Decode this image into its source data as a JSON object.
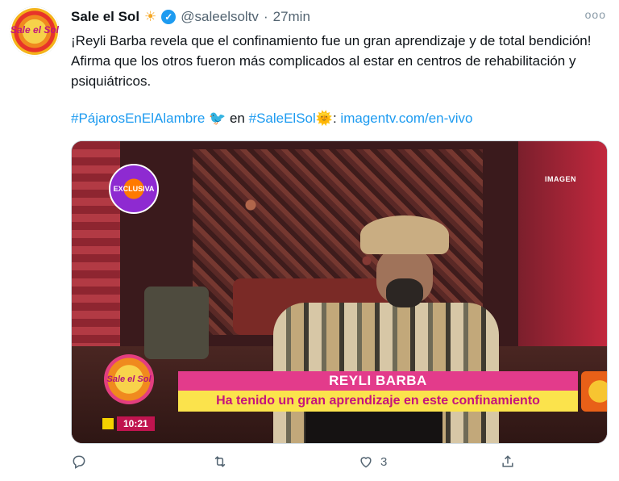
{
  "account": {
    "name": "Sale el Sol",
    "handle": "@saleelsoltv",
    "separator": "·",
    "time": "27min",
    "avatar_text": "Sale el Sol"
  },
  "tweet": {
    "text": "¡Reyli Barba revela que el confinamiento fue un gran aprendizaje y de total bendición! Afirma que los otros fueron más complicados al estar en centros de rehabilitación y psiquiátricos.",
    "hashtag1": "#PájarosEnElAlambre",
    "joiner": "en",
    "hashtag2": "#SaleElSol",
    "colon": ":",
    "url": "imagentv.com/en-vivo"
  },
  "media": {
    "exclusive_badge": "EXCLUSIVA",
    "channel_logo": "IMAGEN",
    "show_logo": "Sale el Sol",
    "clock": "10:21",
    "lower_third_name": "REYLI BARBA",
    "lower_third_caption": "Ha tenido un gran aprendizaje en este confinamiento"
  },
  "actions": {
    "reply_count": "",
    "retweet_count": "",
    "like_count": "3",
    "share_count": ""
  },
  "icons": {
    "verified": "verified-badge-icon",
    "more": "more-icon",
    "reply": "reply-icon",
    "retweet": "retweet-icon",
    "like": "heart-icon",
    "share": "share-icon"
  },
  "colors": {
    "link": "#1d9bf0",
    "verified": "#1d9bf0",
    "lower_third_pink": "#e33b8b",
    "lower_third_yellow": "#fbe34c"
  }
}
